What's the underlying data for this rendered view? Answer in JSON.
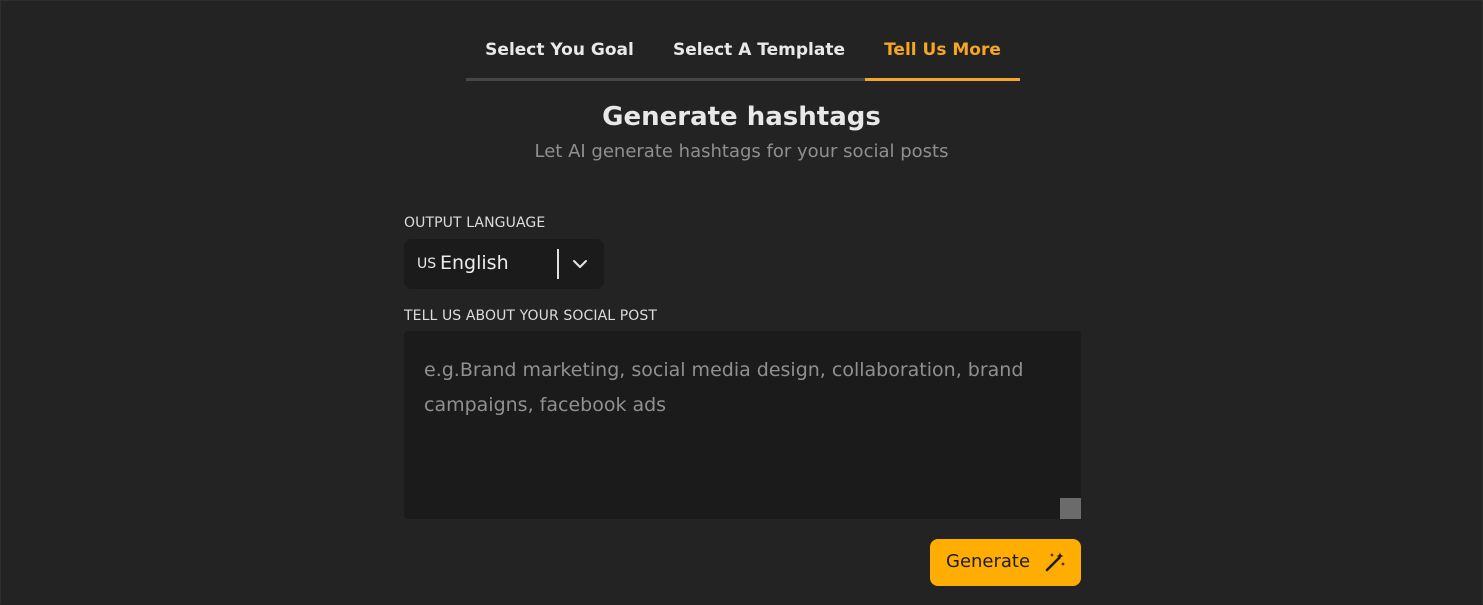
{
  "tabs": [
    {
      "label": "Select You Goal",
      "active": false
    },
    {
      "label": "Select A Template",
      "active": false
    },
    {
      "label": "Tell Us More",
      "active": true
    }
  ],
  "header": {
    "title": "Generate hashtags",
    "subtitle": "Let AI generate hashtags for your social posts"
  },
  "form": {
    "language_label": "OUTPUT LANGUAGE",
    "language_flag": "US",
    "language_value": "English",
    "post_label": "TELL US ABOUT YOUR SOCIAL POST",
    "post_value": "",
    "post_placeholder": "e.g.Brand marketing, social media design, collaboration, brand campaigns, facebook ads",
    "generate_label": "Generate"
  },
  "icons": {
    "dropdown": "chevron-down-icon",
    "generate": "magic-wand-icon"
  },
  "colors": {
    "background": "#232323",
    "accent": "#f5a623",
    "button": "#ffad00",
    "field": "#1b1b1b"
  }
}
